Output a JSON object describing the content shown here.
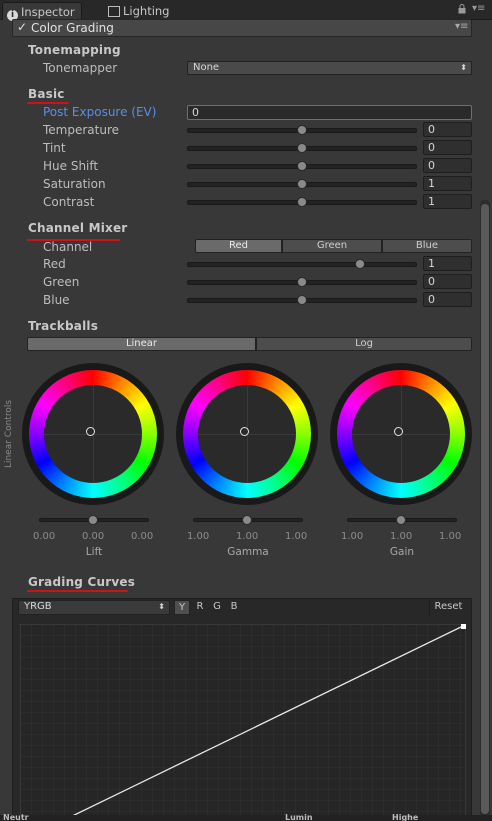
{
  "tabs": [
    {
      "label": "Inspector",
      "icon": "info-icon"
    },
    {
      "label": "Lighting",
      "icon": "lighting-icon"
    }
  ],
  "component": {
    "title": "Color Grading",
    "enabled": true
  },
  "tonemapping": {
    "header": "Tonemapping",
    "label": "Tonemapper",
    "value": "None"
  },
  "basic": {
    "header": "Basic",
    "post_exposure": {
      "label": "Post Exposure (EV)",
      "value": "0"
    },
    "sliders": [
      {
        "label": "Temperature",
        "value": "0",
        "fraction": 0.5
      },
      {
        "label": "Tint",
        "value": "0",
        "fraction": 0.5
      },
      {
        "label": "Hue Shift",
        "value": "0",
        "fraction": 0.5
      },
      {
        "label": "Saturation",
        "value": "1",
        "fraction": 0.5
      },
      {
        "label": "Contrast",
        "value": "1",
        "fraction": 0.5
      }
    ]
  },
  "channel_mixer": {
    "header": "Channel Mixer",
    "channel_label": "Channel",
    "channels": [
      "Red",
      "Green",
      "Blue"
    ],
    "selected": "Red",
    "sliders": [
      {
        "label": "Red",
        "value": "1",
        "fraction": 0.75
      },
      {
        "label": "Green",
        "value": "0",
        "fraction": 0.5
      },
      {
        "label": "Blue",
        "value": "0",
        "fraction": 0.5
      }
    ]
  },
  "trackballs": {
    "header": "Trackballs",
    "modes": [
      "Linear",
      "Log"
    ],
    "selected_mode": "Linear",
    "side_label": "Linear Controls",
    "wheels": [
      {
        "name": "Lift",
        "values": [
          "0.00",
          "0.00",
          "0.00"
        ]
      },
      {
        "name": "Gamma",
        "values": [
          "1.00",
          "1.00",
          "1.00"
        ]
      },
      {
        "name": "Gain",
        "values": [
          "1.00",
          "1.00",
          "1.00"
        ]
      }
    ]
  },
  "grading_curves": {
    "header": "Grading Curves",
    "mode": "YRGB",
    "channels": [
      "Y",
      "R",
      "G",
      "B"
    ],
    "selected_channel": "Y",
    "reset_label": "Reset"
  },
  "status_bar": {
    "items": [
      "Neutr",
      "Lumin",
      "Highe"
    ]
  }
}
